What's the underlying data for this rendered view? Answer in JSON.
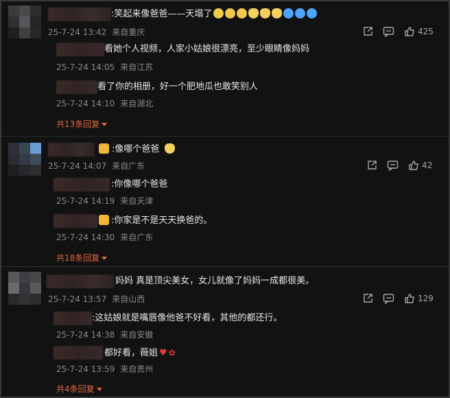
{
  "comments": [
    {
      "prefix": ":",
      "text": "笑起来像爸爸——天塌了",
      "date": "25-7-24 13:42",
      "location": "来自重庆",
      "likes": "425",
      "emojis": [
        "grin-emoji",
        "grin-emoji",
        "grin-emoji",
        "dog-face-emoji",
        "dog-face-emoji",
        "dog-face-emoji",
        "cry-laugh-emoji",
        "cry-laugh-emoji",
        "cry-laugh-emoji"
      ],
      "replies": [
        {
          "text": "看她个人视频，人家小姑娘很漂亮，至少眼睛像妈妈",
          "date": "25-7-24 14:05",
          "location": "来自江苏"
        },
        {
          "text": "看了你的相册，好一个肥地瓜也敢笑别人",
          "date": "25-7-24 14:10",
          "location": "来自湖北"
        }
      ],
      "more": "共13条回复"
    },
    {
      "text": ":像哪个爸爸",
      "date": "25-7-24 14:07",
      "location": "来自广东",
      "likes": "42",
      "replies": [
        {
          "text": ":你像哪个爸爸",
          "date": "25-7-24 14:19",
          "location": "来自天津"
        },
        {
          "text": ":你家是不是天天换爸的。",
          "date": "25-7-24 14:30",
          "location": "来自广东"
        }
      ],
      "more": "共18条回复"
    },
    {
      "text": "妈妈 真是顶尖美女，女儿就像了妈妈一成都很美。",
      "date": "25-7-24 13:57",
      "location": "来自山西",
      "likes": "129",
      "replies": [
        {
          "text": ":这姑娘就是嘴唇像他爸不好看，其他的都还行。",
          "date": "25-7-24 14:38",
          "location": "来自安徽"
        },
        {
          "text": "都好看，薇姐",
          "date": "25-7-24 13:59",
          "location": "来自贵州"
        }
      ],
      "more": "共4条回复"
    }
  ],
  "icons": {
    "share": "share-icon",
    "reply": "comment-icon",
    "like": "thumbs-up-icon"
  },
  "colors": {
    "background": "#121212",
    "accent": "#e0673f",
    "meta": "#8a8a8a"
  }
}
